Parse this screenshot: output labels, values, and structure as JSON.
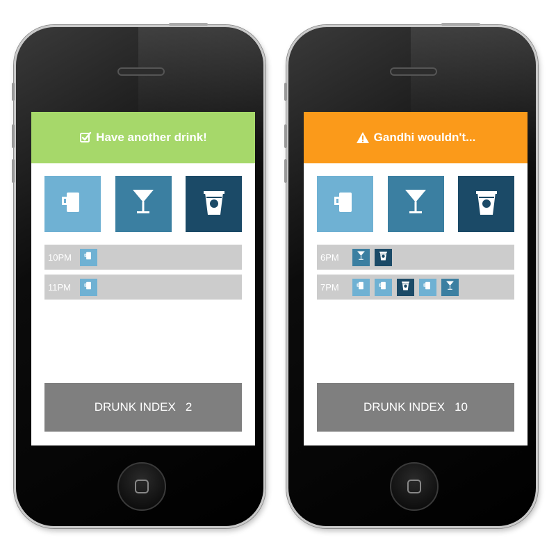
{
  "colors": {
    "good": "#a6d86a",
    "warn": "#fb9a1a",
    "beer": "#6fb1d3",
    "cocktail": "#3b7fa1",
    "shot": "#1b4a67",
    "row_bg": "#cccccc",
    "index_bg": "#7f7f7f"
  },
  "drink_types": [
    {
      "id": "beer",
      "icon": "beer-mug-icon"
    },
    {
      "id": "cocktail",
      "icon": "cocktail-glass-icon"
    },
    {
      "id": "shot",
      "icon": "shot-cup-icon"
    }
  ],
  "phones": [
    {
      "banner": {
        "status": "good",
        "icon": "checkbox-icon",
        "text": "Have another drink!"
      },
      "log": [
        {
          "time": "10PM",
          "drinks": [
            "beer"
          ]
        },
        {
          "time": "11PM",
          "drinks": [
            "beer"
          ]
        }
      ],
      "index": {
        "label": "DRUNK INDEX",
        "value": "2"
      }
    },
    {
      "banner": {
        "status": "warn",
        "icon": "warning-icon",
        "text": "Gandhi wouldn't..."
      },
      "log": [
        {
          "time": "6PM",
          "drinks": [
            "cocktail",
            "shot"
          ]
        },
        {
          "time": "7PM",
          "drinks": [
            "beer",
            "beer",
            "shot",
            "beer",
            "cocktail"
          ]
        }
      ],
      "index": {
        "label": "DRUNK INDEX",
        "value": "10"
      }
    }
  ]
}
